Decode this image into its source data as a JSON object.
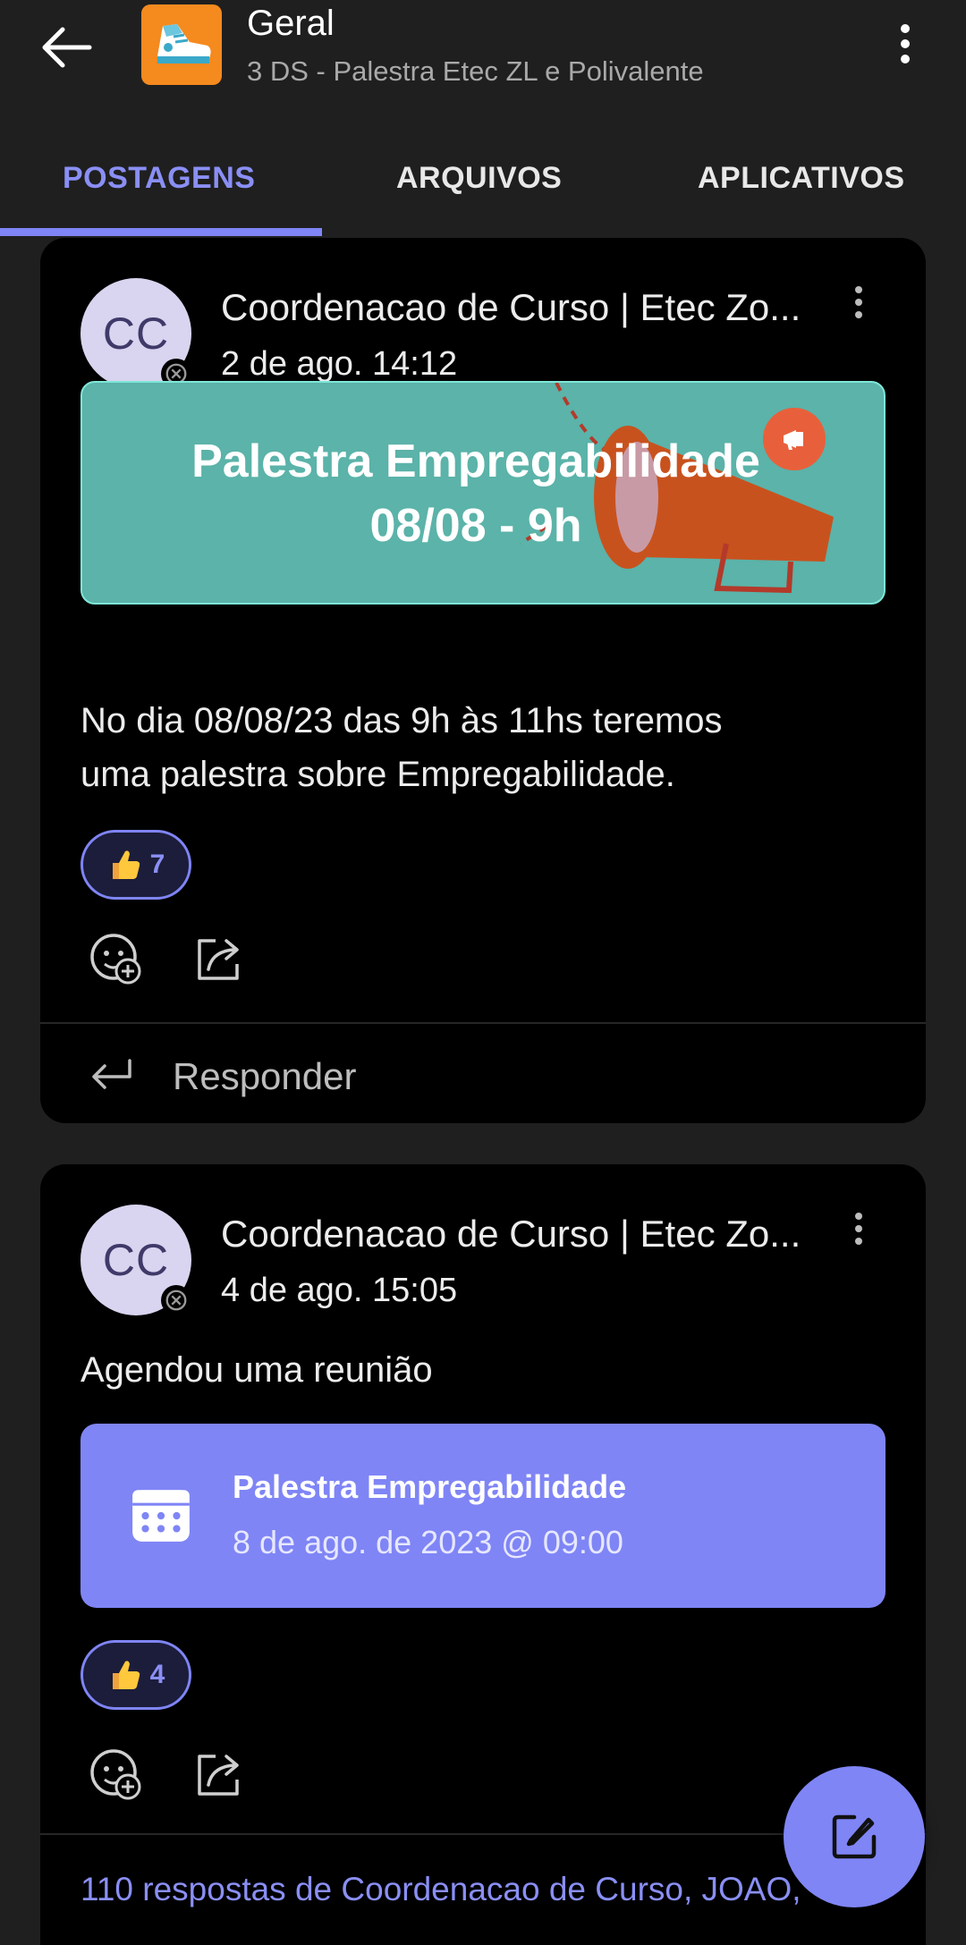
{
  "header": {
    "title": "Geral",
    "subtitle": "3 DS - Palestra Etec ZL e Polivalente"
  },
  "tabs": [
    {
      "label": "POSTAGENS",
      "active": true
    },
    {
      "label": "ARQUIVOS",
      "active": false
    },
    {
      "label": "APLICATIVOS",
      "active": false
    }
  ],
  "colors": {
    "accent": "#7f85f5",
    "banner": "#5bb3a9",
    "team_icon": "#f58a1f",
    "announce_badge": "#e8603b"
  },
  "posts": [
    {
      "avatar_initials": "CC",
      "author": "Coordenacao de Curso | Etec Zo...",
      "time": "2 de ago. 14:12",
      "banner": {
        "line1": "Palestra Empregabilidade",
        "line2": "08/08 - 9h"
      },
      "body_line1": "No dia 08/08/23 das 9h às 11hs teremos",
      "body_line2": "uma palestra sobre Empregabilidade.",
      "reaction": {
        "icon": "thumbs-up-icon",
        "count": "7"
      },
      "reply_label": "Responder"
    },
    {
      "avatar_initials": "CC",
      "author": "Coordenacao de Curso | Etec Zo...",
      "time": "4 de ago. 15:05",
      "body": "Agendou uma reunião",
      "meeting": {
        "title": "Palestra Empregabilidade",
        "date": "8 de ago. de 2023 @ 09:00"
      },
      "reaction": {
        "icon": "thumbs-up-icon",
        "count": "4"
      },
      "replies_text": "110 respostas de Coordenacao de Curso, JOAO,"
    }
  ]
}
